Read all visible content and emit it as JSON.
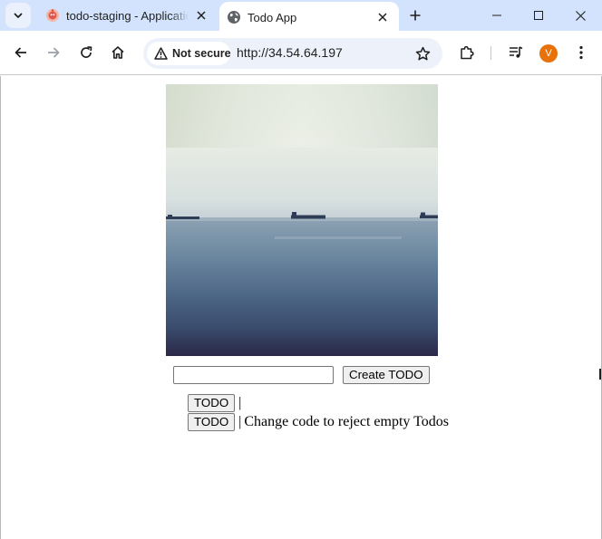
{
  "browser": {
    "tabs": [
      {
        "title": "todo-staging - Application",
        "active": false,
        "favicon": "app-favicon-icon"
      },
      {
        "title": "Todo App",
        "active": true,
        "favicon": "globe-icon"
      }
    ],
    "address_bar": {
      "security_label": "Not secure",
      "url": "http://34.54.64.197"
    },
    "profile_initial": "V",
    "colors": {
      "tabstrip": "#d3e3fd",
      "omnibox": "#edf2fa",
      "avatar": "#e8710a"
    }
  },
  "page": {
    "hero_image": {
      "description_icon": "sea-with-ships-photo"
    },
    "form": {
      "input_value": "",
      "create_button_label": "Create TODO"
    },
    "todos": [
      {
        "button_label": "TODO",
        "separator": "|",
        "text": ""
      },
      {
        "button_label": "TODO",
        "separator": "|",
        "text": "Change code to reject empty Todos"
      }
    ]
  }
}
